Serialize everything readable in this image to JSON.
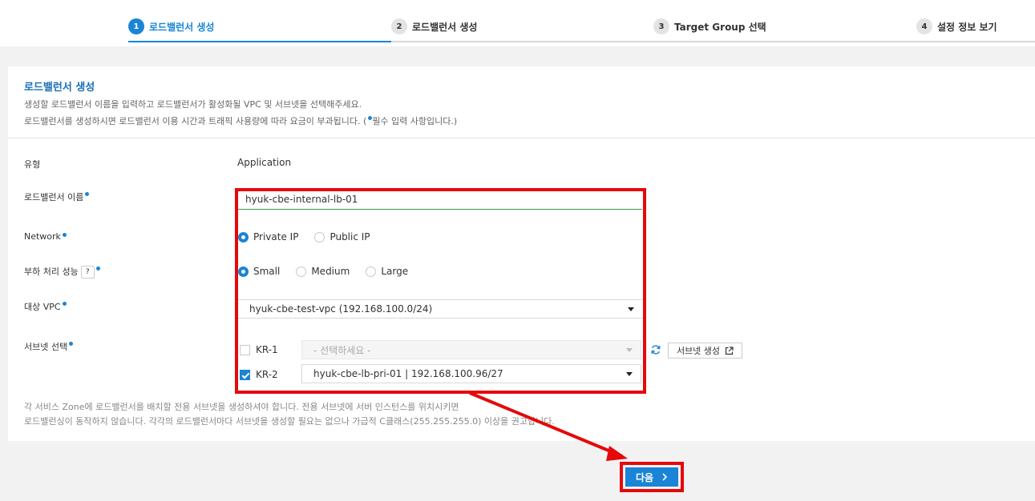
{
  "stepper": {
    "steps": [
      {
        "num": "1",
        "label": "로드밸런서 생성"
      },
      {
        "num": "2",
        "label": "로드밸런서 생성"
      },
      {
        "num": "3",
        "label": "Target Group 선택"
      },
      {
        "num": "4",
        "label": "설정 정보 보기"
      }
    ]
  },
  "header": {
    "title": "로드밸런서 생성",
    "desc1": "생성할 로드밸런서 이름을 입력하고 로드밸런서가 활성화될 VPC 및 서브넷을 선택해주세요.",
    "desc2_pre": "로드밸런서를 생성하시면 로드밸런서 이용 시간과 트래픽 사용량에 따라 요금이 부과됩니다. (",
    "desc2_post": "필수 입력 사항입니다.)"
  },
  "form": {
    "type_label": "유형",
    "type_value": "Application",
    "name_label": "로드밸런서 이름",
    "name_value": "hyuk-cbe-internal-lb-01",
    "network_label": "Network",
    "network_options": [
      "Private IP",
      "Public IP"
    ],
    "network_selected": "Private IP",
    "perf_label": "부하 처리 성능",
    "perf_help": "?",
    "perf_options": [
      "Small",
      "Medium",
      "Large"
    ],
    "perf_selected": "Small",
    "vpc_label": "대상 VPC",
    "vpc_value": "hyuk-cbe-test-vpc (192.168.100.0/24)",
    "subnet_label": "서브넷 선택",
    "subnets": [
      {
        "zone": "KR-1",
        "checked": false,
        "value": "- 선택하세요 -"
      },
      {
        "zone": "KR-2",
        "checked": true,
        "value": "hyuk-cbe-lb-pri-01 | 192.168.100.96/27"
      }
    ],
    "subnet_create_label": "서브넷 생성"
  },
  "notes": {
    "line1": "각 서비스 Zone에 로드밸런서를 배치할 전용 서브넷을 생성하셔야 합니다. 전용 서브넷에 서버 인스턴스를 위치시키면",
    "line2": "로드밸런싱이 동작하지 않습니다. 각각의 로드밸런서마다 서브넷을 생성할 필요는 없으나 가급적 C클래스(255.255.255.0) 이상을 권고합니다."
  },
  "footer": {
    "next_label": "다음"
  },
  "colors": {
    "accent": "#1a84d6",
    "annotation": "#e5090b",
    "valid_underline": "#3aa04f"
  }
}
